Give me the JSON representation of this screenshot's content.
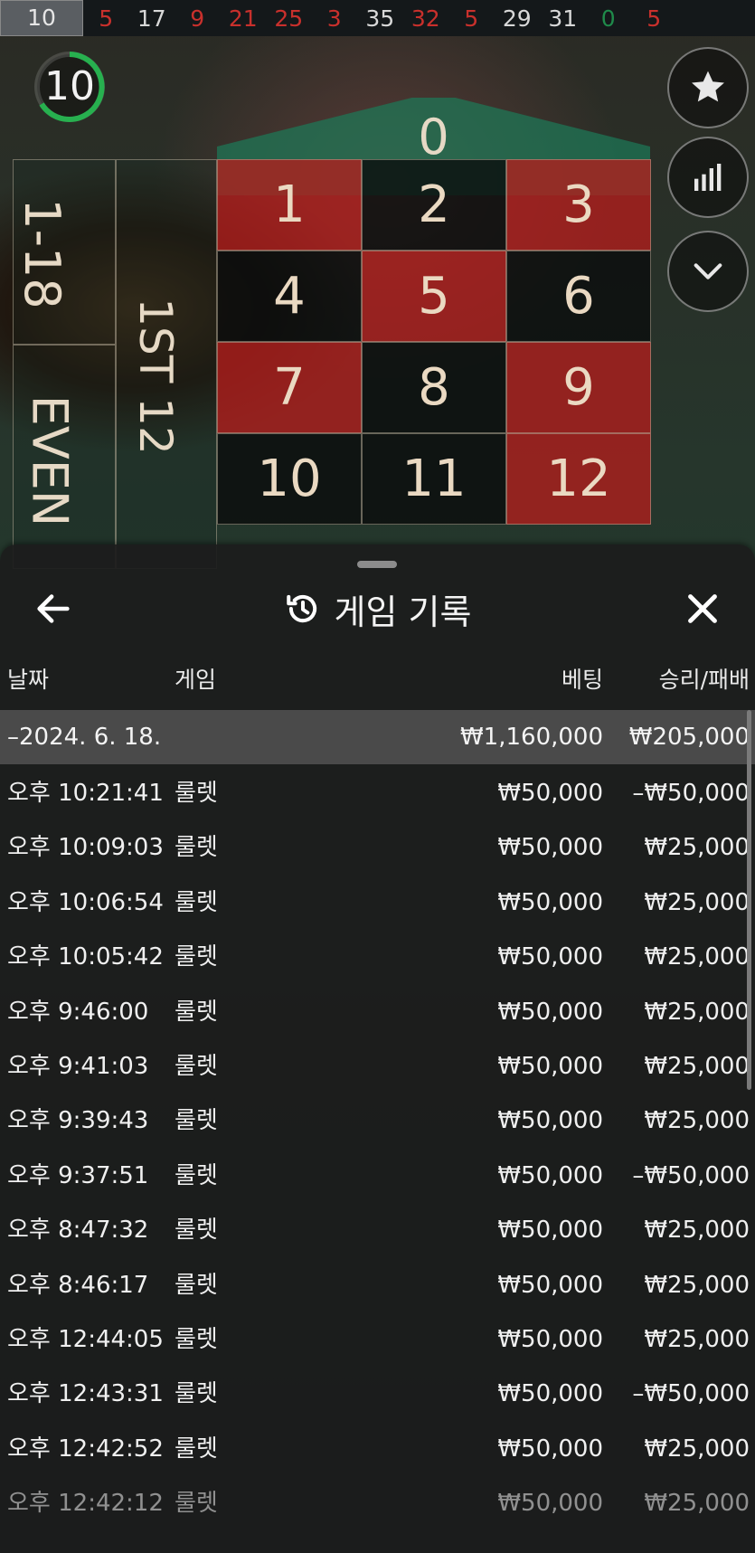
{
  "recent_results": [
    {
      "n": "10",
      "color": "black",
      "latest": true
    },
    {
      "n": "5",
      "color": "red"
    },
    {
      "n": "17",
      "color": "black"
    },
    {
      "n": "9",
      "color": "red"
    },
    {
      "n": "21",
      "color": "red"
    },
    {
      "n": "25",
      "color": "red"
    },
    {
      "n": "3",
      "color": "red"
    },
    {
      "n": "35",
      "color": "black"
    },
    {
      "n": "32",
      "color": "red"
    },
    {
      "n": "5",
      "color": "red"
    },
    {
      "n": "29",
      "color": "black"
    },
    {
      "n": "31",
      "color": "black"
    },
    {
      "n": "0",
      "color": "green"
    },
    {
      "n": "5",
      "color": "red"
    }
  ],
  "timer": {
    "value": "10",
    "accent": "#27b04f"
  },
  "board": {
    "zero": "0",
    "cells": [
      {
        "n": "1",
        "color": "red"
      },
      {
        "n": "2",
        "color": "black"
      },
      {
        "n": "3",
        "color": "red"
      },
      {
        "n": "4",
        "color": "black"
      },
      {
        "n": "5",
        "color": "red"
      },
      {
        "n": "6",
        "color": "black"
      },
      {
        "n": "7",
        "color": "red"
      },
      {
        "n": "8",
        "color": "black"
      },
      {
        "n": "9",
        "color": "red"
      },
      {
        "n": "10",
        "color": "black"
      },
      {
        "n": "11",
        "color": "black"
      },
      {
        "n": "12",
        "color": "red"
      }
    ],
    "side_low": "1-18",
    "side_even": "EVEN",
    "dozen_first": "1ST 12"
  },
  "actions": [
    {
      "name": "favorite-button",
      "icon": "star-icon"
    },
    {
      "name": "statistics-button",
      "icon": "bar-chart-icon"
    },
    {
      "name": "collapse-button",
      "icon": "chevron-down-icon"
    }
  ],
  "history": {
    "title": "게임 기록",
    "columns": {
      "date": "날짜",
      "game": "게임",
      "bet": "베팅",
      "result": "승리/패배"
    },
    "date_group": {
      "date": "–2024. 6. 18.",
      "bet": "₩1,160,000",
      "result": "₩205,000"
    },
    "rows": [
      {
        "time": "오후 10:21:41",
        "game": "룰렛",
        "bet": "₩50,000",
        "result": "–₩50,000"
      },
      {
        "time": "오후 10:09:03",
        "game": "룰렛",
        "bet": "₩50,000",
        "result": "₩25,000"
      },
      {
        "time": "오후 10:06:54",
        "game": "룰렛",
        "bet": "₩50,000",
        "result": "₩25,000"
      },
      {
        "time": "오후 10:05:42",
        "game": "룰렛",
        "bet": "₩50,000",
        "result": "₩25,000"
      },
      {
        "time": "오후 9:46:00",
        "game": "룰렛",
        "bet": "₩50,000",
        "result": "₩25,000"
      },
      {
        "time": "오후 9:41:03",
        "game": "룰렛",
        "bet": "₩50,000",
        "result": "₩25,000"
      },
      {
        "time": "오후 9:39:43",
        "game": "룰렛",
        "bet": "₩50,000",
        "result": "₩25,000"
      },
      {
        "time": "오후 9:37:51",
        "game": "룰렛",
        "bet": "₩50,000",
        "result": "–₩50,000"
      },
      {
        "time": "오후 8:47:32",
        "game": "룰렛",
        "bet": "₩50,000",
        "result": "₩25,000"
      },
      {
        "time": "오후 8:46:17",
        "game": "룰렛",
        "bet": "₩50,000",
        "result": "₩25,000"
      },
      {
        "time": "오후 12:44:05",
        "game": "룰렛",
        "bet": "₩50,000",
        "result": "₩25,000"
      },
      {
        "time": "오후 12:43:31",
        "game": "룰렛",
        "bet": "₩50,000",
        "result": "–₩50,000"
      },
      {
        "time": "오후 12:42:52",
        "game": "룰렛",
        "bet": "₩50,000",
        "result": "₩25,000"
      },
      {
        "time": "오후 12:42:12",
        "game": "룰렛",
        "bet": "₩50,000",
        "result": "₩25,000"
      }
    ]
  }
}
